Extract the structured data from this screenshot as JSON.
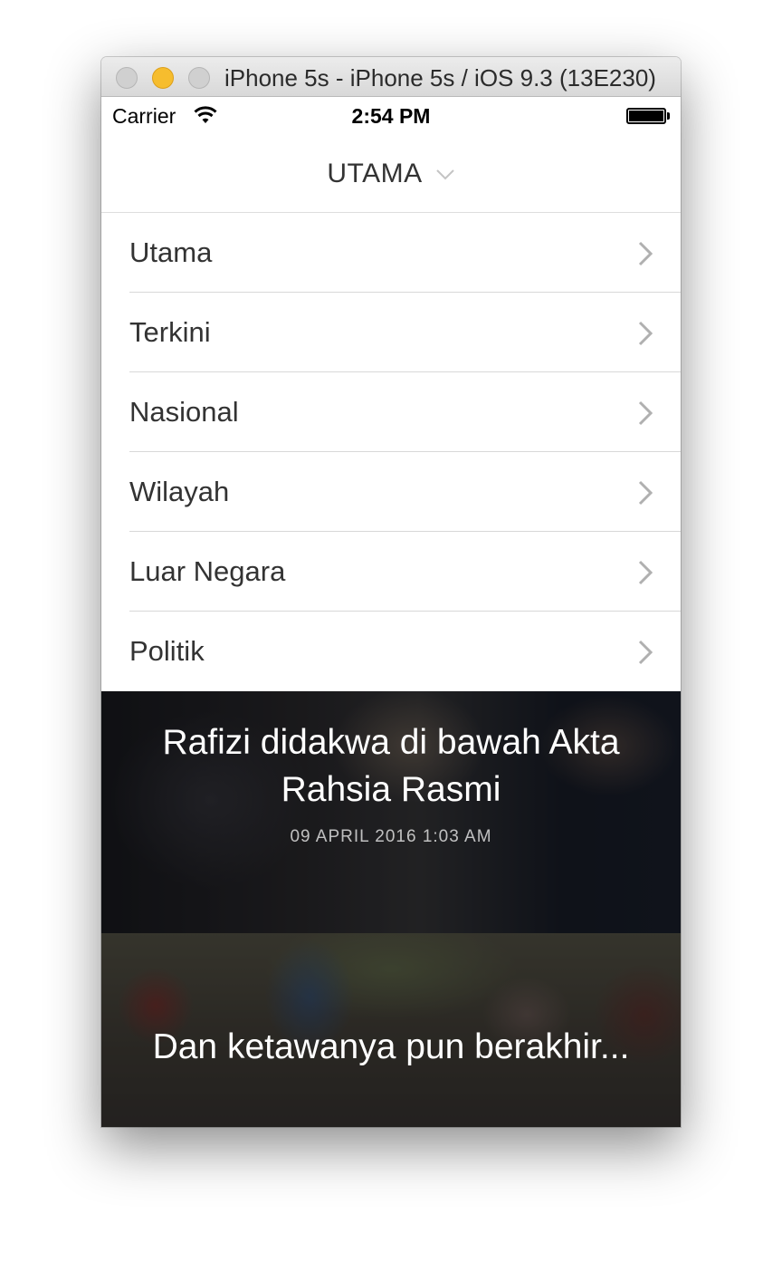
{
  "window": {
    "title": "iPhone 5s - iPhone 5s / iOS 9.3 (13E230)"
  },
  "statusbar": {
    "carrier": "Carrier",
    "time": "2:54 PM"
  },
  "navbar": {
    "title": "UTAMA"
  },
  "menu": {
    "items": [
      {
        "label": "Utama"
      },
      {
        "label": "Terkini"
      },
      {
        "label": "Nasional"
      },
      {
        "label": "Wilayah"
      },
      {
        "label": "Luar Negara"
      },
      {
        "label": "Politik"
      }
    ]
  },
  "news": [
    {
      "title": "Rafizi didakwa di bawah Akta Rahsia Rasmi",
      "date": "09 APRIL 2016 1:03 AM"
    },
    {
      "title": "Dan ketawanya pun berakhir..."
    }
  ],
  "colors": {
    "accent_traffic_minimize": "#f6bd2e",
    "text": "#333333",
    "separator": "#d8d8d8"
  }
}
